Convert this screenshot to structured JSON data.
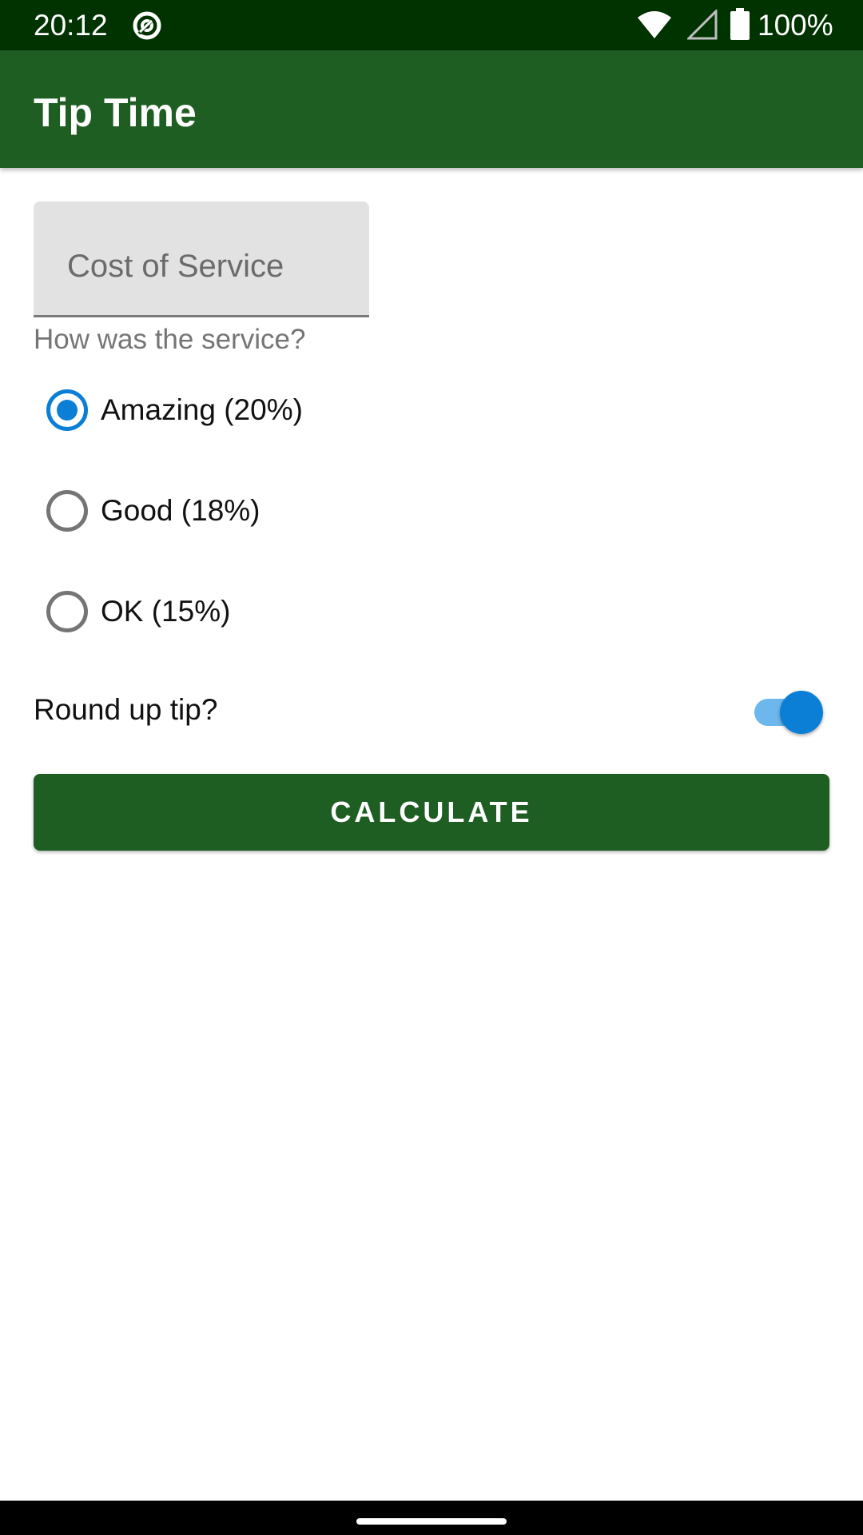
{
  "status_bar": {
    "time": "20:12",
    "battery_percent": "100%",
    "icons": [
      "at-sign-icon",
      "wifi-icon",
      "cell-signal-icon",
      "battery-icon"
    ]
  },
  "app_bar": {
    "title": "Tip Time"
  },
  "cost_field": {
    "placeholder": "Cost of Service",
    "value": ""
  },
  "service_question": "How was the service?",
  "tip_options": [
    {
      "label": "Amazing (20%)",
      "checked": true
    },
    {
      "label": "Good (18%)",
      "checked": false
    },
    {
      "label": "OK (15%)",
      "checked": false
    }
  ],
  "round_up": {
    "label": "Round up tip?",
    "enabled": true
  },
  "calculate_button": {
    "label": "CALCULATE"
  },
  "colors": {
    "status_bar": "#003300",
    "primary": "#1e5e22",
    "accent": "#0b7fd6",
    "field_background": "#e2e2e2"
  }
}
